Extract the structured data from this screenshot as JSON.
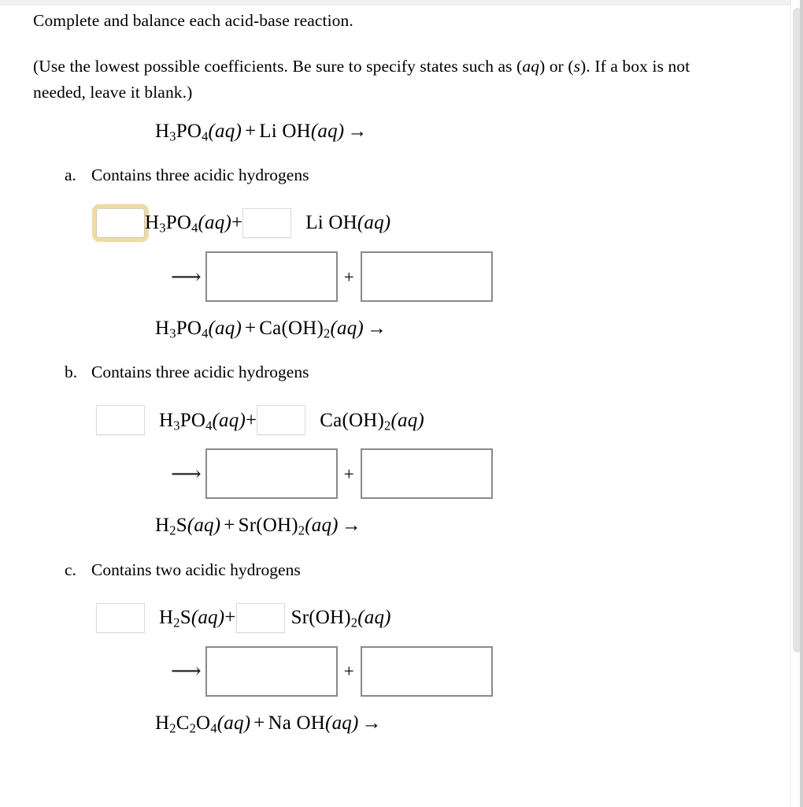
{
  "prompt": {
    "line1": "Complete and balance each acid-base reaction.",
    "line2_a": "(Use the lowest possible coefficients. Be sure to specify states such as (",
    "line2_aq": "aq",
    "line2_b": ") or (",
    "line2_s": "s",
    "line2_c": "). If a box is not needed, leave it blank.)"
  },
  "problems": [
    {
      "letter": "a.",
      "hint": "Contains three acidic hydrogens",
      "header": {
        "acid_formula": "H",
        "acid_sub1": "3",
        "acid_mid": "PO",
        "acid_sub2": "4",
        "acid_state": "(aq)",
        "plus": "+",
        "base": "Li OH",
        "base_state": "(aq)",
        "arrow": "→"
      },
      "reactants": {
        "acid_label": "H₃PO₄(aq)",
        "plus": "+",
        "base_label": "Li OH(aq)",
        "coef1_value": "",
        "coef2_value": "",
        "coef1_focused": true
      },
      "products": {
        "arrow": "⟶",
        "plus": "+",
        "box1_value": "",
        "box2_value": ""
      }
    },
    {
      "letter": "b.",
      "hint": "Contains three acidic hydrogens",
      "header": {
        "acid_state": "(aq)",
        "plus": "+",
        "base_state": "(aq)",
        "arrow": "→"
      },
      "reactants": {
        "plus": "+",
        "coef1_value": "",
        "coef2_value": "",
        "coef1_focused": false
      },
      "products": {
        "arrow": "⟶",
        "plus": "+",
        "box1_value": "",
        "box2_value": ""
      }
    },
    {
      "letter": "c.",
      "hint": "Contains two acidic hydrogens",
      "header": {
        "acid_state": "(aq)",
        "plus": "+",
        "base_state": "(aq)",
        "arrow": "→"
      },
      "reactants": {
        "plus": "+",
        "coef1_value": "",
        "coef2_value": "",
        "coef1_focused": false
      },
      "products": {
        "arrow": "⟶",
        "plus": "+",
        "box1_value": "",
        "box2_value": ""
      }
    }
  ],
  "final_equation": {
    "acid_state": "(aq)",
    "plus": "+",
    "base": "Na OH",
    "base_state": "(aq)",
    "arrow": "→"
  },
  "scrollbar": {
    "orientation": "vertical",
    "thumb_color": "#e3e3e3"
  }
}
